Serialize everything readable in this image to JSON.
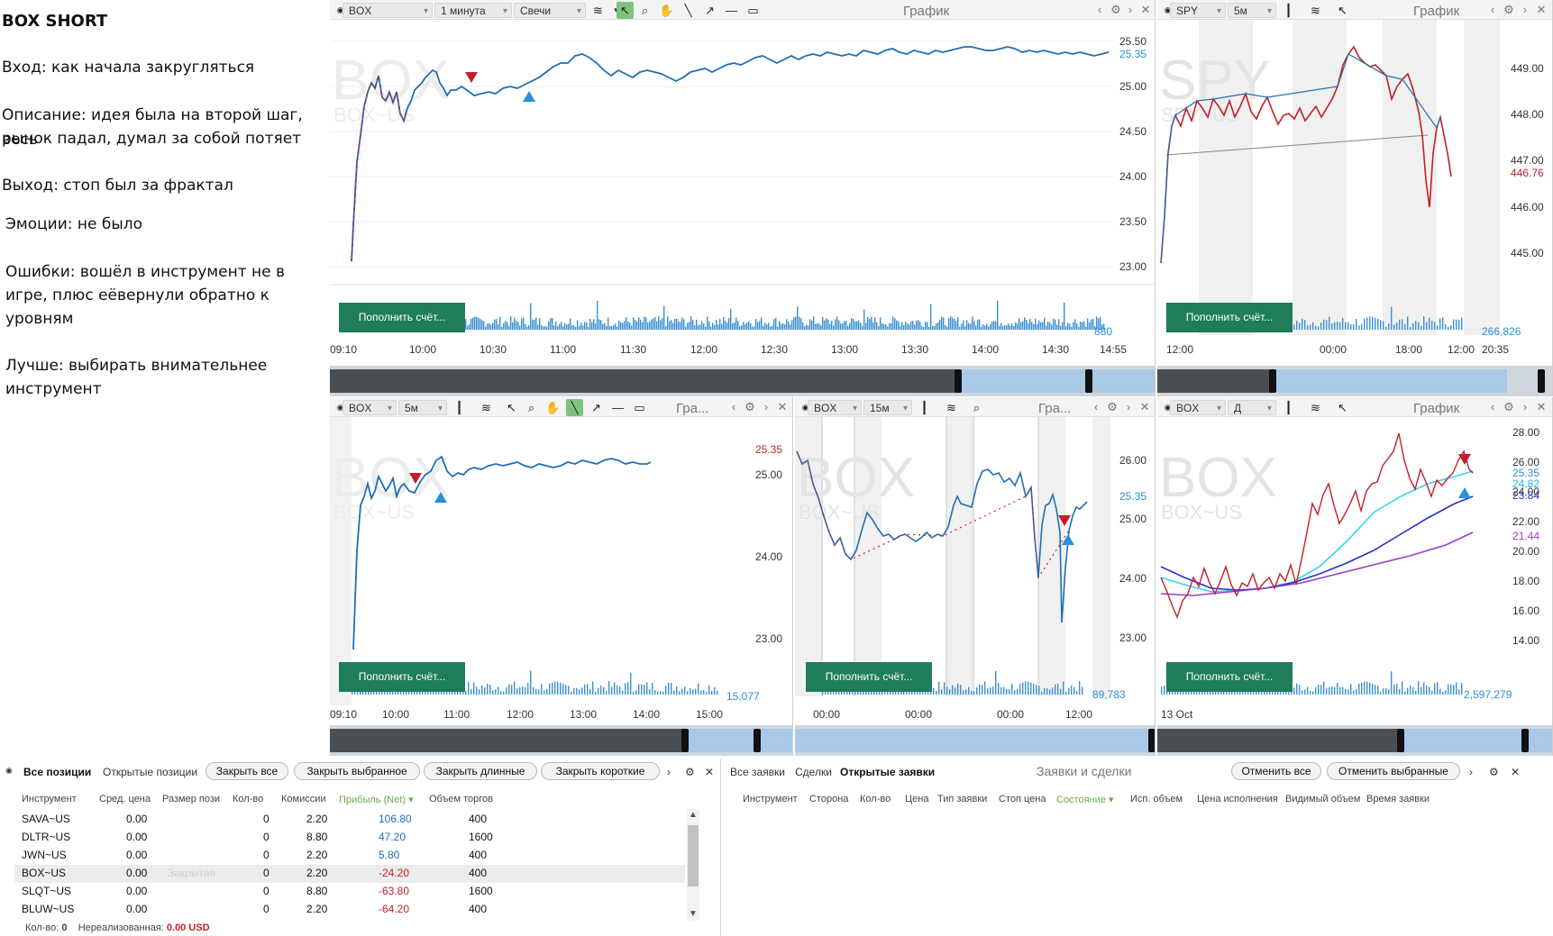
{
  "notes": {
    "title": "BOX SHORT",
    "entry": "Вход: как начала закругляться",
    "description_1": "Описание: идея была на второй шаг, весь",
    "description_2": "рынок падал, думал за собой потяет",
    "exit": "Выход: стоп был за фрактал",
    "emotions": "Эмоции: не было",
    "errors_1": "Ошибки: вошёл в инструмент не в",
    "errors_2": "игре, плюс еёвернули обратно к",
    "errors_3": "уровням",
    "better_1": "Лучше: выбирать внимательнее",
    "better_2": "инструмент"
  },
  "common": {
    "chart_caption": "График",
    "chart_caption_short": "Гра...",
    "deposit_button": "Пополнить счёт...",
    "colors": {
      "up": "#1f6fb5",
      "down": "#c41e2a",
      "accent_green": "#1f7d5a",
      "volume": "#3b8fd0"
    }
  },
  "charts": {
    "box_1m": {
      "symbol": "BOX",
      "interval": "1 минута",
      "type": "Свечи",
      "watermark": "BOX",
      "watermark_sub": "BOX~US",
      "yticks": [
        "25.50",
        "25.00",
        "24.50",
        "24.00",
        "23.50",
        "23.00"
      ],
      "last_price": "25.35",
      "xticks": [
        "09:10",
        "10:00",
        "10:30",
        "11:00",
        "11:30",
        "12:00",
        "12:30",
        "13:00",
        "13:30",
        "14:00",
        "14:30",
        "14:55"
      ],
      "volume_label": "880"
    },
    "spy_5m": {
      "symbol": "SPY",
      "interval": "5м",
      "watermark": "SPY",
      "watermark_sub": "SPY~US",
      "yticks": [
        "449.00",
        "448.00",
        "447.00",
        "446.00",
        "445.00"
      ],
      "last_price": "446.76",
      "xticks": [
        "12:00",
        "00:00",
        "18:00",
        "12:00",
        "20:35"
      ],
      "volume_label": "266,826"
    },
    "box_5m": {
      "symbol": "BOX",
      "interval": "5м",
      "watermark": "BOX",
      "watermark_sub": "BOX~US",
      "yticks": [
        "25.00",
        "24.00",
        "23.00"
      ],
      "last_price": "25.35",
      "xticks": [
        "09:10",
        "10:00",
        "11:00",
        "12:00",
        "13:00",
        "14:00",
        "15:00"
      ],
      "volume_label": "15,077"
    },
    "box_15m": {
      "symbol": "BOX",
      "interval": "15м",
      "watermark": "BOX",
      "watermark_sub": "BOX~US",
      "yticks": [
        "26.00",
        "25.00",
        "24.00",
        "23.00"
      ],
      "last_price": "25.35",
      "xticks": [
        "00:00",
        "00:00",
        "00:00",
        "12:00"
      ],
      "volume_label": "89,783"
    },
    "box_d": {
      "symbol": "BOX",
      "interval": "Д",
      "watermark": "BOX",
      "watermark_sub": "BOX~US",
      "yticks": [
        "28.00",
        "26.00",
        "24.00",
        "22.00",
        "20.00",
        "18.00",
        "16.00",
        "14.00"
      ],
      "last_price": "25.35",
      "ma_labels": [
        "24.82",
        "23.84",
        "21.44"
      ],
      "xticks": [
        "13 Oct"
      ],
      "volume_label": "2,597,279"
    }
  },
  "positions": {
    "tabs": [
      "Все позиции",
      "Открытые позиции"
    ],
    "buttons": [
      "Закрыть все",
      "Закрыть выбранное",
      "Закрыть длинные",
      "Закрыть короткие"
    ],
    "columns": [
      "Инструмент",
      "Сред. цена",
      "Размер пози",
      "Кол-во",
      "Комиссии",
      "Прибыль (Net)",
      "Объем торгов"
    ],
    "rows": [
      {
        "symbol": "SAVA~US",
        "avg": "0.00",
        "status": "",
        "qty": "0",
        "fee": "2.20",
        "pnl": "106.80",
        "vol": "400",
        "pos": true
      },
      {
        "symbol": "DLTR~US",
        "avg": "0.00",
        "status": "",
        "qty": "0",
        "fee": "8.80",
        "pnl": "47.20",
        "vol": "1600",
        "pos": true
      },
      {
        "symbol": "JWN~US",
        "avg": "0.00",
        "status": "",
        "qty": "0",
        "fee": "2.20",
        "pnl": "5.80",
        "vol": "400",
        "pos": true
      },
      {
        "symbol": "BOX~US",
        "avg": "0.00",
        "status": "Закрытая",
        "qty": "0",
        "fee": "2.20",
        "pnl": "-24.20",
        "vol": "400",
        "pos": false
      },
      {
        "symbol": "SLQT~US",
        "avg": "0.00",
        "status": "",
        "qty": "0",
        "fee": "8.80",
        "pnl": "-63.80",
        "vol": "1600",
        "pos": false
      },
      {
        "symbol": "BLUW~US",
        "avg": "0.00",
        "status": "",
        "qty": "0",
        "fee": "2.20",
        "pnl": "-64.20",
        "vol": "400",
        "pos": false
      }
    ],
    "footer_qty_label": "Кол-во:",
    "footer_qty": "0",
    "footer_unreal_label": "Нереализованная:",
    "footer_unreal": "0.00 USD"
  },
  "orders": {
    "tabs": [
      "Все заявки",
      "Сделки",
      "Открытые заявки"
    ],
    "caption": "Заявки и сделки",
    "buttons": [
      "Отменить все",
      "Отменить выбранные"
    ],
    "columns": [
      "Инструмент",
      "Сторона",
      "Кол-во",
      "Цена",
      "Тип заявки",
      "Стоп цена",
      "Состояние",
      "Исп. объем",
      "Цена исполнения",
      "Видимый объем",
      "Время заявки"
    ]
  }
}
